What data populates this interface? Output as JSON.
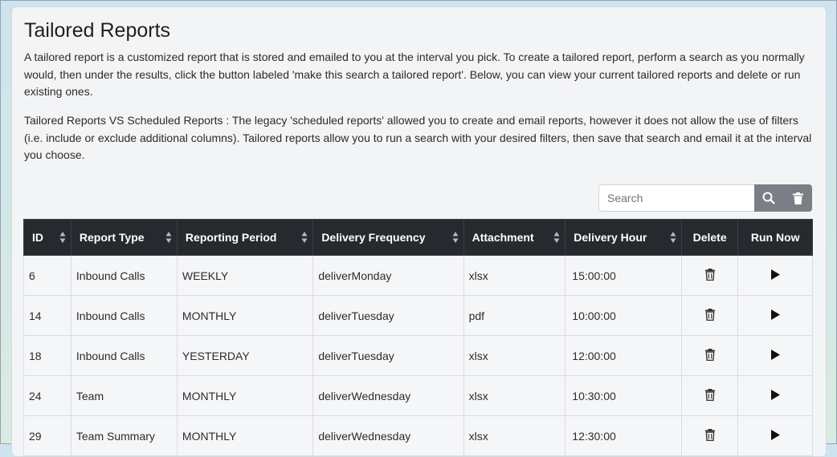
{
  "page": {
    "title": "Tailored Reports",
    "intro": "A tailored report is a customized report that is stored and emailed to you at the interval you pick. To create a tailored report, perform a search as you normally would, then under the results, click the button labeled 'make this search a tailored report'. Below, you can view your current tailored reports and delete or run existing ones.",
    "comparison": "Tailored Reports VS Scheduled Reports : The legacy 'scheduled reports' allowed you to create and email reports, however it does not allow the use of filters (i.e. include or exclude additional columns). Tailored reports allow you to run a search with your desired filters, then save that search and email it at the interval you choose."
  },
  "search": {
    "placeholder": "Search",
    "value": "",
    "search_icon": "search-icon",
    "clear_icon": "trash-icon"
  },
  "table": {
    "columns": [
      "ID",
      "Report Type",
      "Reporting Period",
      "Delivery Frequency",
      "Attachment",
      "Delivery Hour",
      "Delete",
      "Run Now"
    ],
    "rows": [
      {
        "id": "6",
        "report_type": "Inbound Calls",
        "period": "WEEKLY",
        "frequency": "deliverMonday",
        "attachment": "xlsx",
        "hour": "15:00:00"
      },
      {
        "id": "14",
        "report_type": "Inbound Calls",
        "period": "MONTHLY",
        "frequency": "deliverTuesday",
        "attachment": "pdf",
        "hour": "10:00:00"
      },
      {
        "id": "18",
        "report_type": "Inbound Calls",
        "period": "YESTERDAY",
        "frequency": "deliverTuesday",
        "attachment": "xlsx",
        "hour": "12:00:00"
      },
      {
        "id": "24",
        "report_type": "Team",
        "period": "MONTHLY",
        "frequency": "deliverWednesday",
        "attachment": "xlsx",
        "hour": "10:30:00"
      },
      {
        "id": "29",
        "report_type": "Team Summary",
        "period": "MONTHLY",
        "frequency": "deliverWednesday",
        "attachment": "xlsx",
        "hour": "12:30:00"
      }
    ],
    "delete_icon": "trash-icon",
    "run_icon": "play-icon"
  }
}
